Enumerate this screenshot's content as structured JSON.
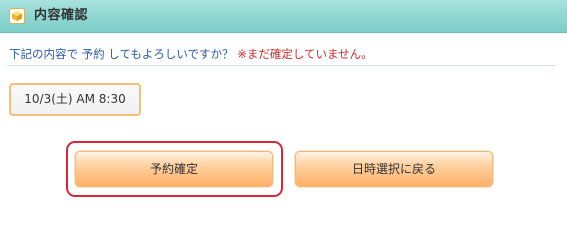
{
  "header": {
    "title": "内容確認",
    "icon": "cube-icon"
  },
  "message": {
    "prefix": "下記の内容で ",
    "action": "予約",
    "question": " してもよろしいですか？ ",
    "warning": "※まだ確定していません。"
  },
  "reservation": {
    "datetime": "10/3(土) AM 8:30"
  },
  "buttons": {
    "confirm_label": "予約確定",
    "back_label": "日時選択に戻る"
  },
  "colors": {
    "header": "#8fd6d1",
    "message_text": "#2a5aa8",
    "warning_text": "#d42a2a",
    "button_orange": "#ffb067",
    "highlight_frame": "#d9263a"
  }
}
